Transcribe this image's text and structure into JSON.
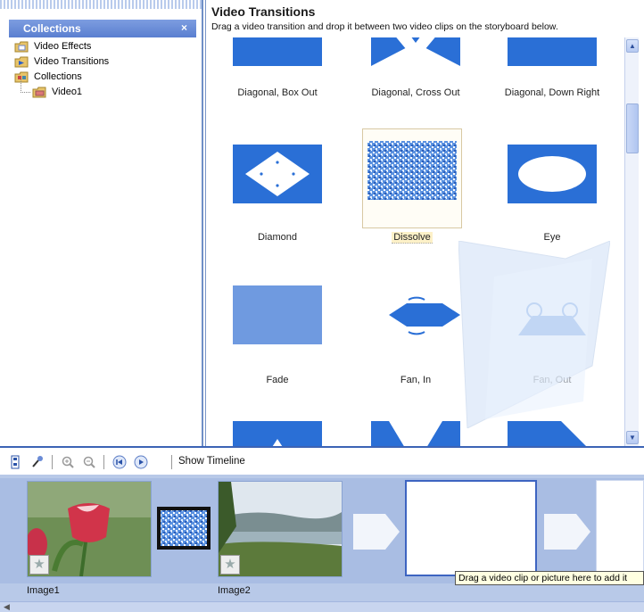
{
  "collections": {
    "header": "Collections",
    "close": "×",
    "items": [
      {
        "label": "Video Effects",
        "icon": "folder-effects-icon"
      },
      {
        "label": "Video Transitions",
        "icon": "folder-transitions-icon"
      },
      {
        "label": "Collections",
        "icon": "folder-collections-icon"
      },
      {
        "label": "Video1",
        "icon": "collection-folder-icon"
      }
    ]
  },
  "content": {
    "title": "Video Transitions",
    "subtitle": "Drag a video transition and drop it between two video clips on the storyboard below.",
    "transitions": [
      {
        "label": "Diagonal, Box Out",
        "icon": "diagonal-box-out-icon"
      },
      {
        "label": "Diagonal, Cross Out",
        "icon": "diagonal-cross-out-icon"
      },
      {
        "label": "Diagonal, Down Right",
        "icon": "diagonal-down-right-icon"
      },
      {
        "label": "Diamond",
        "icon": "diamond-icon"
      },
      {
        "label": "Dissolve",
        "icon": "dissolve-icon",
        "selected": true
      },
      {
        "label": "Eye",
        "icon": "eye-icon"
      },
      {
        "label": "Fade",
        "icon": "fade-icon"
      },
      {
        "label": "Fan, In",
        "icon": "fan-in-icon"
      },
      {
        "label": "Fan, Out",
        "icon": "fan-out-icon"
      }
    ]
  },
  "storyboard_toolbar": {
    "show_timeline": "Show Timeline",
    "icons": [
      "storyboard-icon",
      "narrate-icon",
      "zoom-in-icon",
      "zoom-out-icon",
      "rewind-icon",
      "play-icon"
    ]
  },
  "storyboard": {
    "clips": [
      {
        "name": "Image1",
        "thumbnail": "red-tulip-photo"
      },
      {
        "name": "Image2",
        "thumbnail": "lake-landscape-photo"
      }
    ],
    "tooltip": "Drag a video clip or picture here to add it"
  },
  "colors": {
    "accent": "#3c63b5",
    "panel_header": "#5a7fd0",
    "transition_blue": "#2a6fd6",
    "storyboard_bg": "#a9bde3"
  }
}
